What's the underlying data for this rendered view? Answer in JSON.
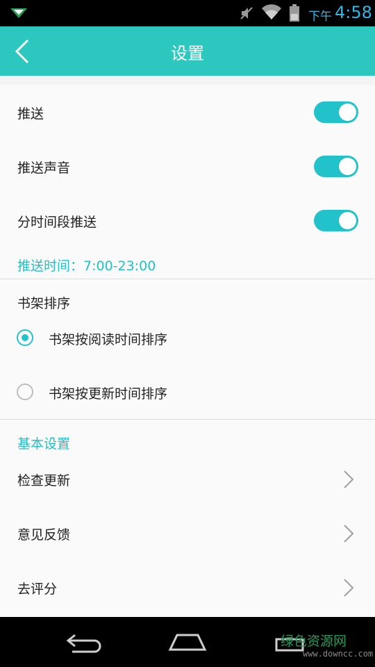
{
  "status_bar": {
    "ampm": "下午",
    "time": "4:58",
    "icons": [
      "app-notification-icon",
      "mute-icon",
      "wifi-icon",
      "battery-icon"
    ]
  },
  "header": {
    "title": "设置",
    "back_icon": "chevron-left-icon"
  },
  "push_settings": {
    "items": [
      {
        "label": "推送",
        "enabled": true
      },
      {
        "label": "推送声音",
        "enabled": true
      },
      {
        "label": "分时间段推送",
        "enabled": true
      }
    ],
    "time_range": "推送时间：7:00-23:00"
  },
  "shelf_sort": {
    "title": "书架排序",
    "options": [
      {
        "label": "书架按阅读时间排序",
        "selected": true
      },
      {
        "label": "书架按更新时间排序",
        "selected": false
      }
    ]
  },
  "basic": {
    "title": "基本设置",
    "items": [
      {
        "label": "检查更新"
      },
      {
        "label": "意见反馈"
      },
      {
        "label": "去评分"
      }
    ]
  },
  "nav_bar": {
    "icons": [
      "back-nav-icon",
      "home-nav-icon",
      "recents-nav-icon"
    ],
    "watermark_title": "绿色资源网",
    "watermark_url": "www.downcc.com"
  },
  "colors": {
    "accent": "#2cc8bf",
    "toggle": "#22c2cb",
    "status_blue": "#33b5e5"
  }
}
